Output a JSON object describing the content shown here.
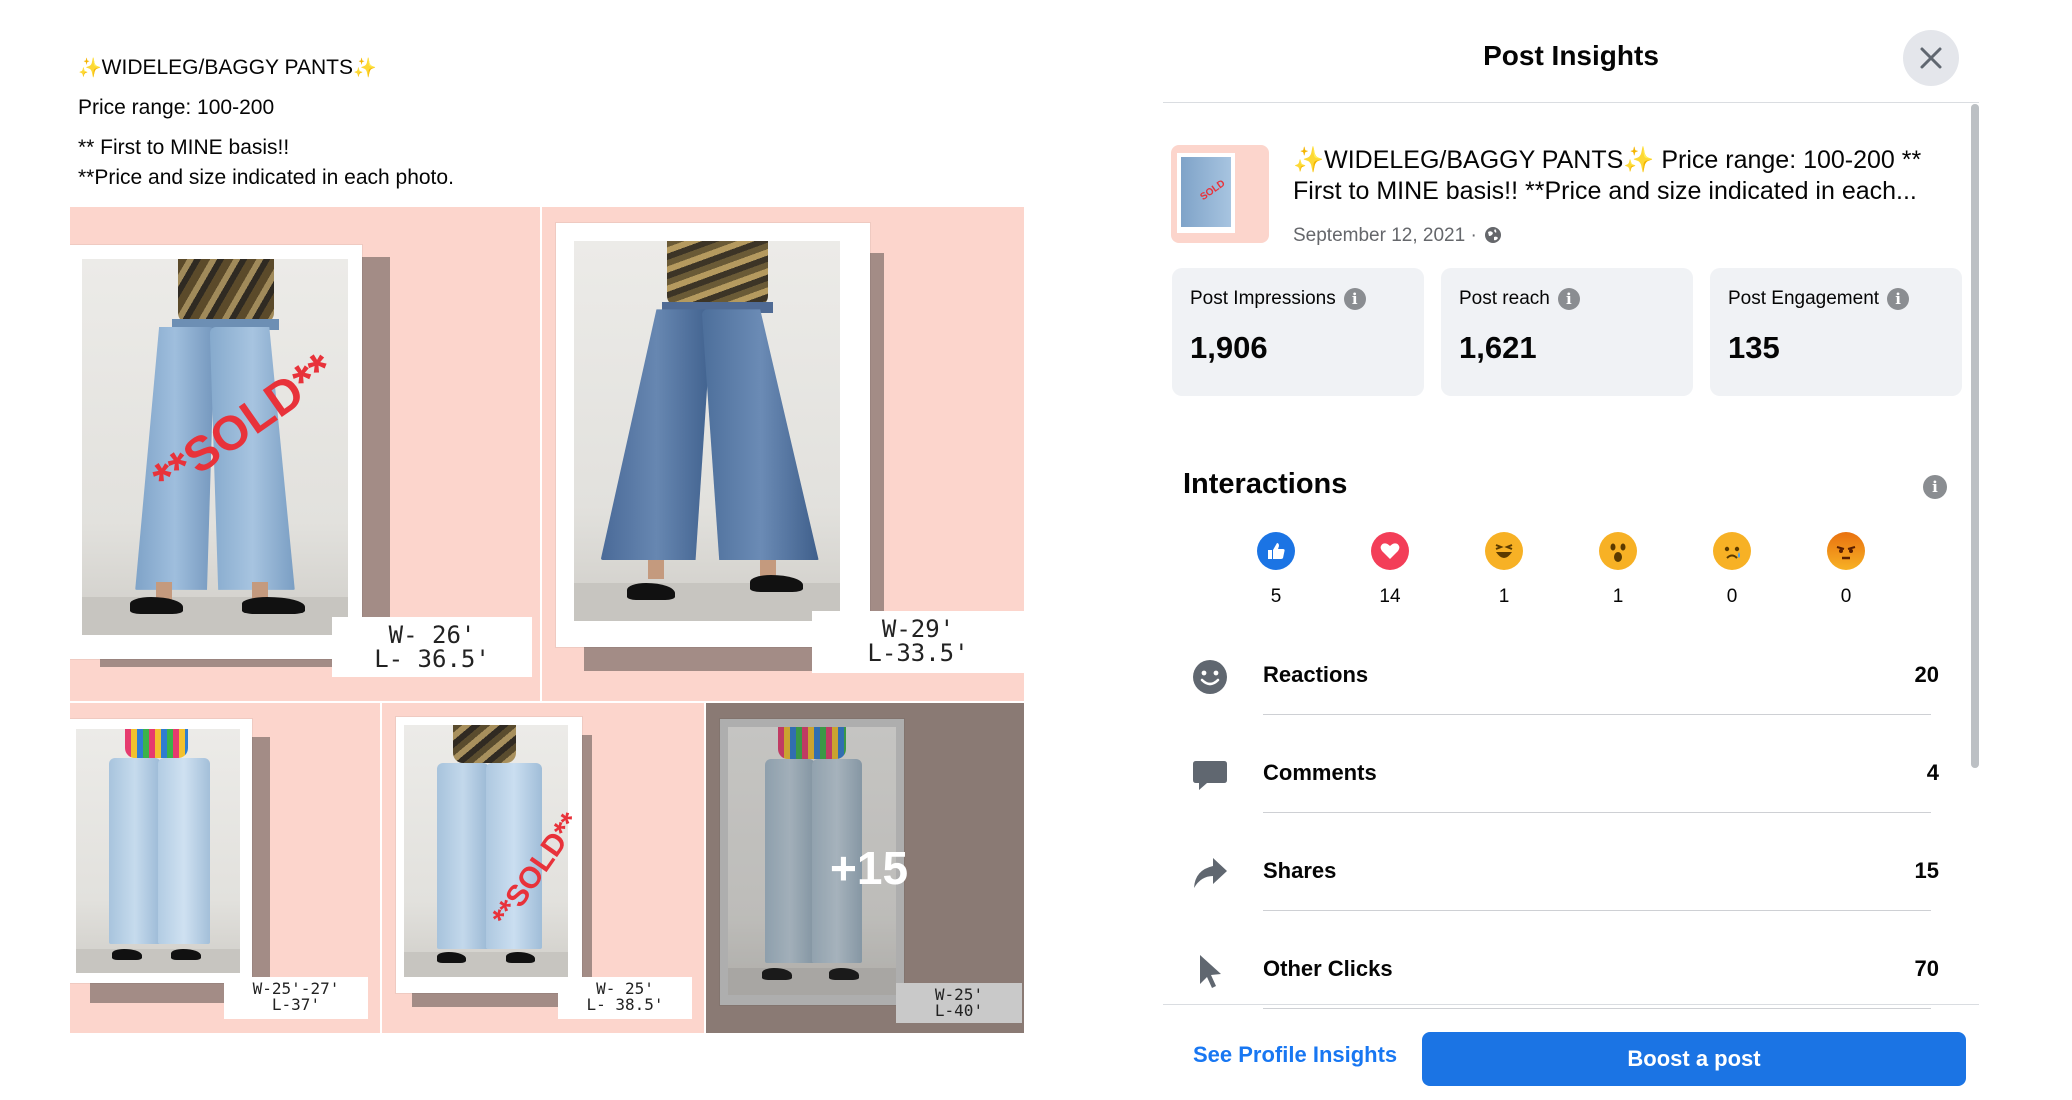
{
  "post": {
    "title": "WIDELEG/BAGGY PANTS",
    "sparkle": "✨",
    "price_line": "Price range: 100-200",
    "note1": "** First to MINE basis!!",
    "note2": "**Price and size indicated in each photo.",
    "photos": [
      {
        "size_line1": "W- 26'",
        "size_line2": "L- 36.5'",
        "sold_text": "**SOLD**"
      },
      {
        "size_line1": "W-29'",
        "size_line2": "L-33.5'"
      },
      {
        "size_line1": "W-25'-27'",
        "size_line2": "L-37'"
      },
      {
        "size_line1": "W- 25'",
        "size_line2": "L- 38.5'",
        "sold_text": "**SOLD**"
      },
      {
        "size_line1": "W-25'",
        "size_line2": "L-40'",
        "more_count": "+15"
      }
    ]
  },
  "insights": {
    "title": "Post Insights",
    "post_text": "✨WIDELEG/BAGGY PANTS✨ Price range: 100-200 ** First to MINE basis!! **Price and size indicated in each...",
    "date": "September 12, 2021 ·",
    "stats": [
      {
        "label": "Post Impressions",
        "value": "1,906"
      },
      {
        "label": "Post reach",
        "value": "1,621"
      },
      {
        "label": "Post Engagement",
        "value": "135"
      }
    ],
    "interactions_title": "Interactions",
    "reactions": [
      {
        "icon": "like-icon",
        "count": "5"
      },
      {
        "icon": "love-icon",
        "count": "14"
      },
      {
        "icon": "haha-icon",
        "count": "1"
      },
      {
        "icon": "wow-icon",
        "count": "1"
      },
      {
        "icon": "sad-icon",
        "count": "0"
      },
      {
        "icon": "angry-icon",
        "count": "0"
      }
    ],
    "metrics": [
      {
        "icon": "smiley-icon",
        "label": "Reactions",
        "value": "20"
      },
      {
        "icon": "comment-icon",
        "label": "Comments",
        "value": "4"
      },
      {
        "icon": "share-icon",
        "label": "Shares",
        "value": "15"
      },
      {
        "icon": "cursor-icon",
        "label": "Other Clicks",
        "value": "70"
      }
    ],
    "see_profile_label": "See Profile Insights",
    "boost_label": "Boost a post"
  },
  "colors": {
    "accent": "#1b74e4",
    "link": "#1877f2",
    "card_bg": "#f0f2f5",
    "pink_bg": "#fcd5cc",
    "sold_red": "#e8323a"
  }
}
